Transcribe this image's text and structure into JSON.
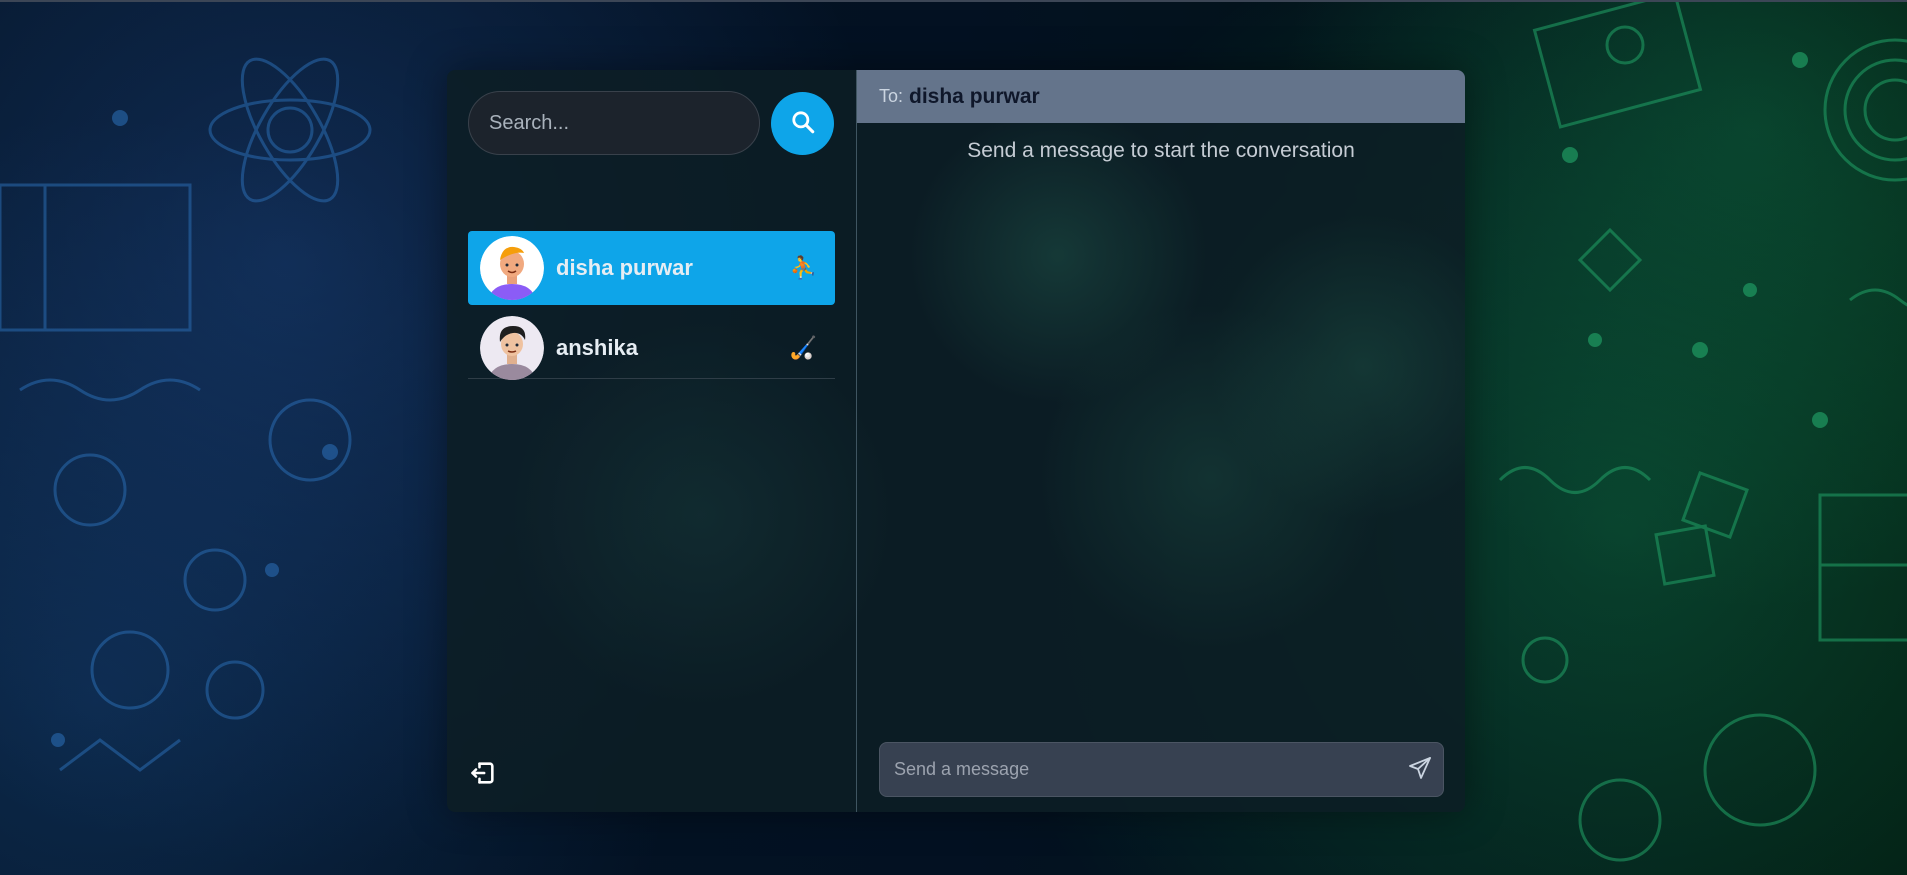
{
  "sidebar": {
    "search": {
      "placeholder": "Search..."
    },
    "conversations": [
      {
        "name": "disha purwar",
        "emoji": "⛹",
        "active": true
      },
      {
        "name": "anshika",
        "emoji": "🏑",
        "active": false
      }
    ]
  },
  "chat": {
    "header": {
      "to_label": "To:",
      "recipient": "disha purwar"
    },
    "empty_message": "Send a message to start the conversation",
    "composer": {
      "placeholder": "Send a message"
    }
  },
  "colors": {
    "accent": "#0ea5e9",
    "header_bg": "#64748b"
  },
  "icons": {
    "search_button": "search-icon",
    "logout": "logout-icon",
    "send": "send-icon"
  }
}
